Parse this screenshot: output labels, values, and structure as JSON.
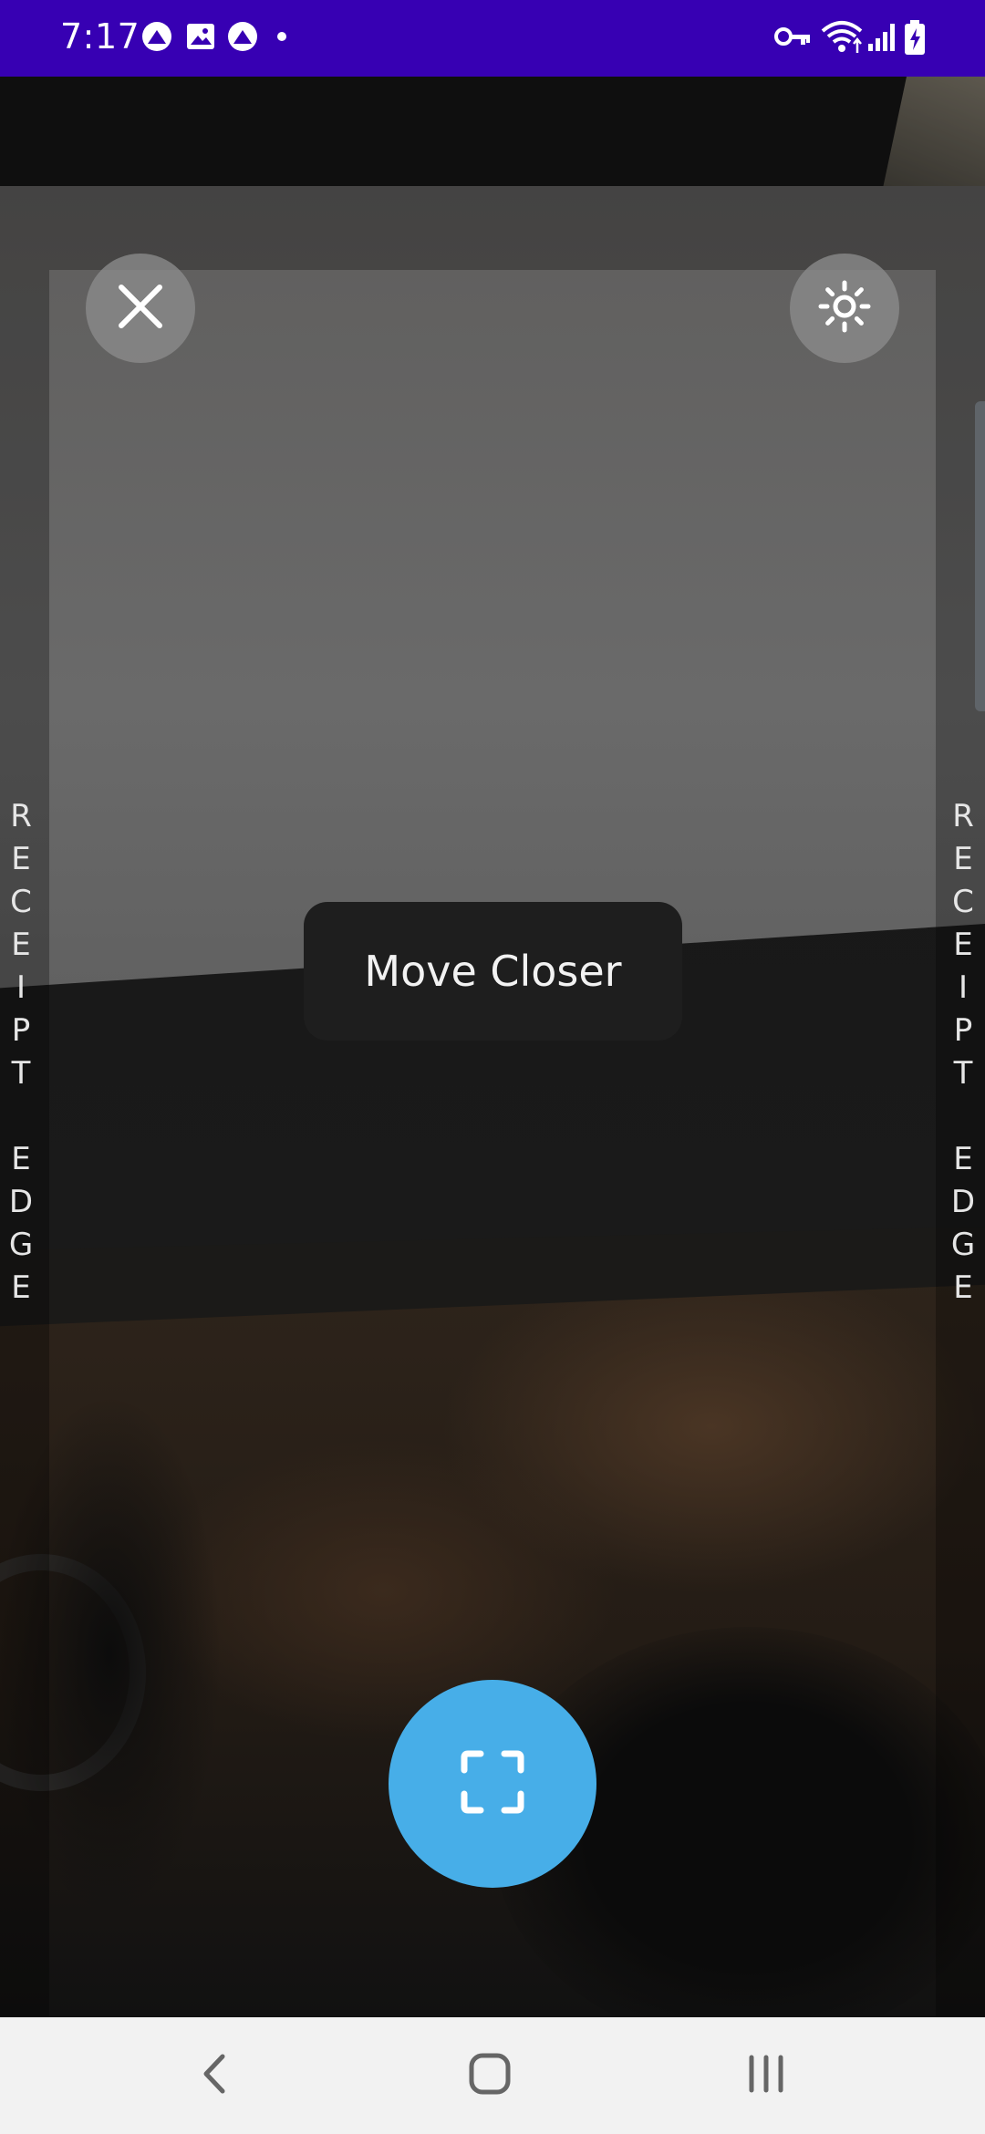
{
  "status_bar": {
    "time": "7:17",
    "left_icons": [
      "app-notification-icon",
      "gallery-icon",
      "app-notification-icon",
      "dot-icon"
    ],
    "right_icons": [
      "vpn-key-icon",
      "wifi-icon",
      "signal-icon",
      "battery-charging-icon"
    ],
    "background_color": "#3700b3"
  },
  "camera": {
    "close_icon": "close-icon",
    "flash_icon": "brightness-icon",
    "edge_label_left": "R\nE\nC\nE\nI\nP\nT\n\nE\nD\nG\nE",
    "edge_label_right": "R\nE\nC\nE\nI\nP\nT\n\nE\nD\nG\nE",
    "hint": "Move Closer",
    "capture_icon": "scan-frame-icon",
    "capture_color": "#47aee8"
  },
  "nav_bar": {
    "back_icon": "back-icon",
    "home_icon": "home-icon",
    "recents_icon": "recents-icon"
  }
}
